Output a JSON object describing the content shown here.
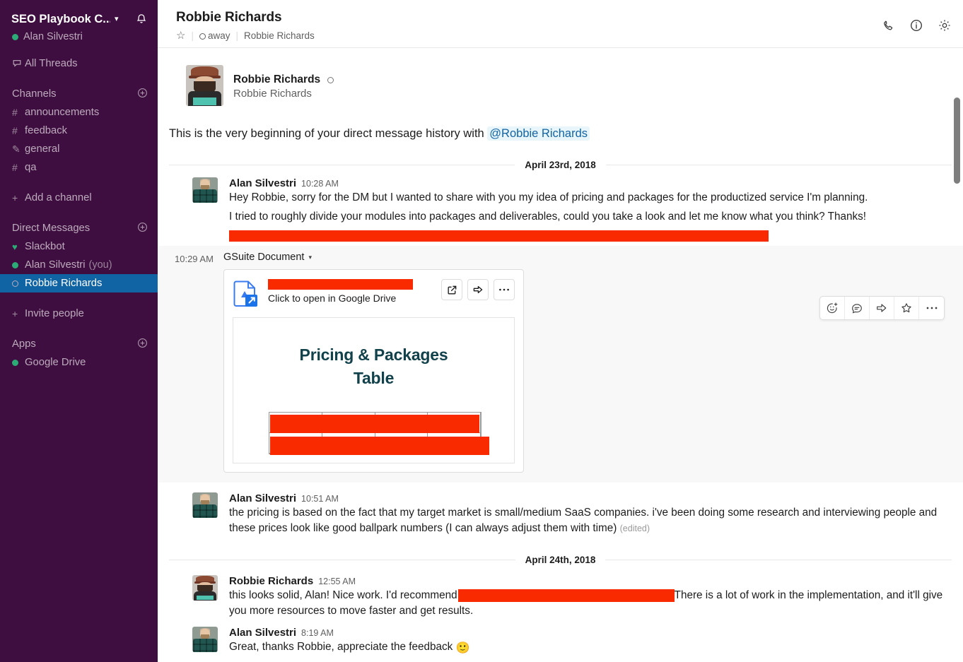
{
  "sidebar": {
    "team_name": "SEO Playbook C...",
    "team_caret": "▾",
    "user_presence": "Alan Silvestri",
    "all_threads": "All Threads",
    "channels_header": "Channels",
    "channels": [
      {
        "glyph": "#",
        "label": "announcements"
      },
      {
        "glyph": "#",
        "label": "feedback"
      },
      {
        "glyph": "✎",
        "label": "general"
      },
      {
        "glyph": "#",
        "label": "qa"
      }
    ],
    "add_channel": "Add a channel",
    "dms_header": "Direct Messages",
    "dms": [
      {
        "glyph": "♥",
        "label": "Slackbot",
        "you": "",
        "selected": false,
        "status": "heart"
      },
      {
        "glyph": "●",
        "label": "Alan Silvestri",
        "you": "(you)",
        "selected": false,
        "status": "online"
      },
      {
        "glyph": "○",
        "label": "Robbie Richards",
        "you": "",
        "selected": true,
        "status": "away"
      }
    ],
    "invite_people": "Invite people",
    "apps_header": "Apps",
    "apps": [
      {
        "label": "Google Drive",
        "status": "online"
      }
    ],
    "add_glyph": "+",
    "selected_color": "#1164A3",
    "background_color": "#3F0E40"
  },
  "header": {
    "title": "Robbie Richards",
    "status_text": "away",
    "full_name": "Robbie Richards",
    "separator": "|",
    "actions": [
      "call-icon",
      "info-icon",
      "settings-icon"
    ]
  },
  "intro": {
    "name": "Robbie Richards",
    "handle": "Robbie Richards",
    "text_before": "This is the very beginning of your direct message history with",
    "mention": "@Robbie Richards"
  },
  "dividers": {
    "day1": "April 23rd, 2018",
    "day2": "April 24th, 2018"
  },
  "messages": [
    {
      "author": "Alan Silvestri",
      "time": "10:28 AM",
      "line1": "Hey Robbie, sorry for the DM but I wanted to share with you my idea of pricing and packages for the productized service I'm planning.",
      "line2": "I tried to roughly divide your modules into  packages and deliverables, could you take a look and let me know what you think? Thanks!",
      "line3_redacted": true
    },
    {
      "author": "Alan Silvestri",
      "time": "10:51 AM",
      "line1": "the pricing is based on the fact that my target market is small/medium SaaS companies. i've been doing some research and interviewing people and these prices look like good ballpark numbers (I can always adjust them with time)",
      "edited": "(edited)"
    },
    {
      "author": "Robbie Richards",
      "time": "12:55 AM",
      "part1": "this looks solid, Alan! Nice work. I'd recommend",
      "part2": "There is a lot of work in the implementation, and it'll give you more resources to move faster and get results."
    },
    {
      "author": "Alan Silvestri",
      "time": "8:19 AM",
      "line1": "Great, thanks Robbie, appreciate the feedback",
      "emoji": "🙂"
    }
  ],
  "attachment": {
    "time": "10:29 AM",
    "type_label": "GSuite Document",
    "type_caret": "▾",
    "subtitle": "Click to open in Google Drive",
    "icon": "google-docs-icon",
    "actions": [
      "open-external-icon",
      "share-icon",
      "more-options-icon"
    ],
    "preview_title_line1": "Pricing & Packages",
    "preview_title_line2": "Table",
    "preview_title_color": "#11414B"
  },
  "hover_toolbar": {
    "buttons": [
      "add-reaction-icon",
      "start-thread-icon",
      "share-message-icon",
      "save-item-icon",
      "more-actions-icon"
    ]
  },
  "redaction_color": "#FA2A00"
}
